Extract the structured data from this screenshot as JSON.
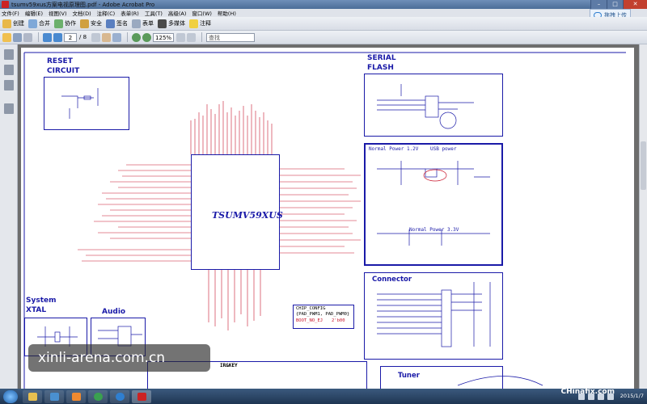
{
  "window": {
    "title": "tsumv59xus方案电视原理图.pdf - Adobe Acrobat Pro",
    "min": "–",
    "max": "□",
    "close": "✕"
  },
  "menu": [
    "文件(F)",
    "编辑(E)",
    "视图(V)",
    "文档(D)",
    "注释(C)",
    "表单(R)",
    "工具(T)",
    "高级(A)",
    "窗口(W)",
    "帮助(H)"
  ],
  "cloud_button": "拖拽上传",
  "toolbar1": {
    "create": "创建",
    "combine": "合并",
    "collaborate": "协作",
    "secure": "安全",
    "sign": "签名",
    "forms": "表单",
    "multimedia": "多媒体",
    "comment": "注释"
  },
  "toolbar2": {
    "page_current": "2",
    "page_total": "/ 8",
    "zoom": "125%",
    "find_placeholder": "查找"
  },
  "schematic": {
    "reset_title": "RESET",
    "reset_sub": "CIRCUIT",
    "serial_title": "SERIAL",
    "serial_sub": "FLASH",
    "chip_name": "TSUMV59XUS",
    "power_title": "Normal Power 1.2V",
    "power_usb": "USB power",
    "power_33": "Normal Power 3.3V",
    "connector_title": "Connector",
    "system_title": "System",
    "xtal_title": "XTAL",
    "audio_title": "Audio",
    "config_line1": "CHIP_CONFIG",
    "config_line2": "{PAD_PWM1, PAD_PWM0}",
    "config_line3": "BOOT_NO_EJ",
    "config_val": "2'b00",
    "irkey_title": "IR&KEY",
    "tuner_title": "Tuner"
  },
  "watermark": "xinli-arena.com.cn",
  "taskbar": {
    "brand": "CHinafix.com",
    "clock_line1": "",
    "clock_line2": "2015/1/7"
  },
  "colors": {
    "schematic_blue": "#1a1aa8",
    "schematic_red": "#c8142a"
  }
}
